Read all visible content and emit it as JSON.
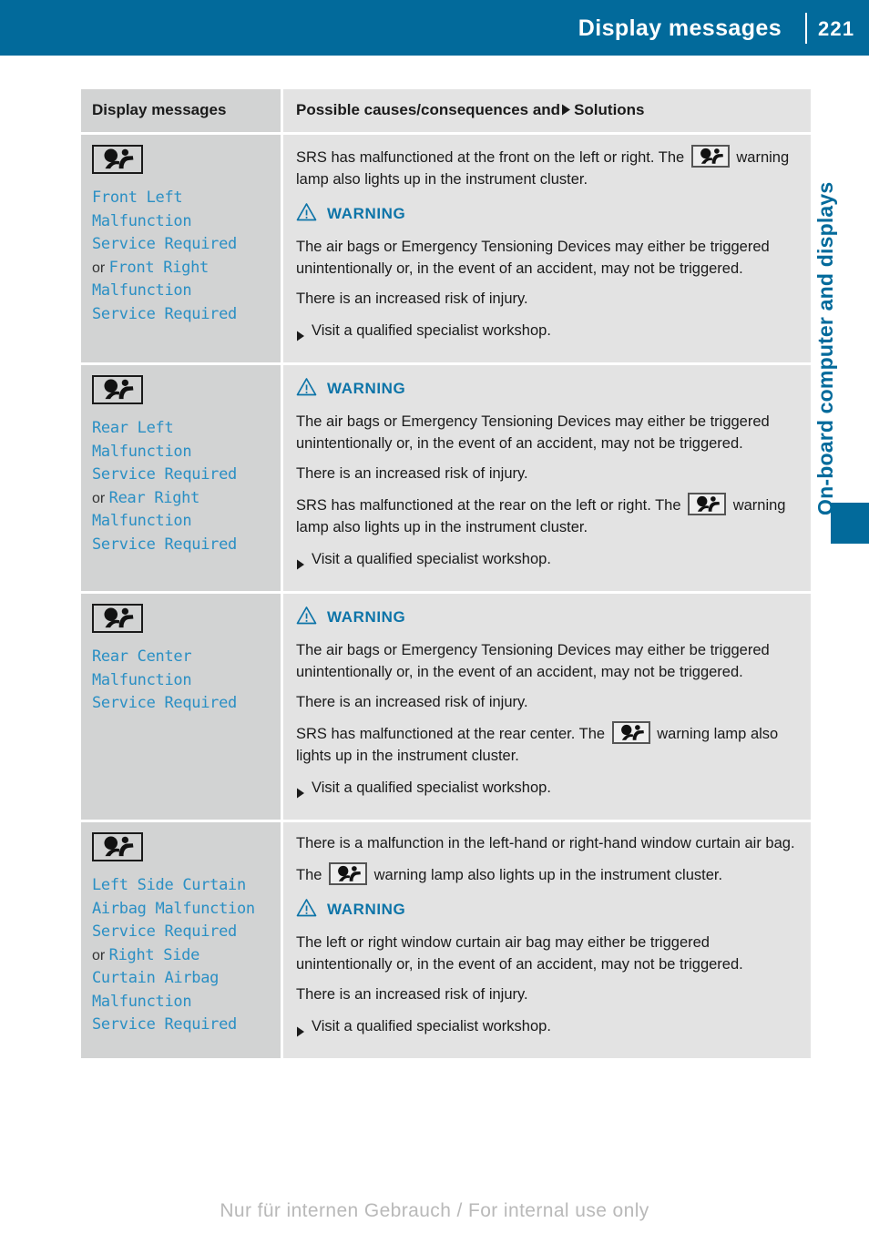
{
  "header": {
    "title": "Display messages",
    "page_number": "221"
  },
  "side": {
    "chapter_label": "On-board computer and displays"
  },
  "table": {
    "columns": {
      "left": "Display messages",
      "right_before": "Possible causes/consequences and",
      "right_after": "Solutions"
    },
    "rows": [
      {
        "icon": "srs-airbag-icon",
        "message_lines": [
          {
            "text": "Front Left",
            "style": "code"
          },
          {
            "text": "Malfunction",
            "style": "code"
          },
          {
            "text": "Service Required",
            "style": "code"
          },
          {
            "text": "or ",
            "style": "plain",
            "code_after": "Front Right"
          },
          {
            "text": "Malfunction",
            "style": "code"
          },
          {
            "text": "Service Required",
            "style": "code"
          }
        ],
        "blocks": [
          {
            "type": "text_with_icon",
            "before": "SRS has malfunctioned at the front on the left or right. The",
            "icon": "srs-airbag-icon",
            "after": "warning lamp also lights up in the instrument cluster."
          },
          {
            "type": "warning_head",
            "label": "WARNING"
          },
          {
            "type": "text",
            "text": "The air bags or Emergency Tensioning Devices may either be triggered unintentionally or, in the event of an accident, may not be triggered."
          },
          {
            "type": "text",
            "text": "There is an increased risk of injury."
          },
          {
            "type": "action",
            "text": "Visit a qualified specialist workshop."
          }
        ]
      },
      {
        "icon": "srs-airbag-icon",
        "message_lines": [
          {
            "text": "Rear Left",
            "style": "code"
          },
          {
            "text": "Malfunction",
            "style": "code"
          },
          {
            "text": "Service Required",
            "style": "code"
          },
          {
            "text": "or ",
            "style": "plain",
            "code_after": "Rear Right"
          },
          {
            "text": "Malfunction",
            "style": "code"
          },
          {
            "text": "Service Required",
            "style": "code"
          }
        ],
        "blocks": [
          {
            "type": "warning_head",
            "label": "WARNING"
          },
          {
            "type": "text",
            "text": "The air bags or Emergency Tensioning Devices may either be triggered unintentionally or, in the event of an accident, may not be triggered."
          },
          {
            "type": "text",
            "text": "There is an increased risk of injury."
          },
          {
            "type": "text_with_icon",
            "before": "SRS has malfunctioned at the rear on the left or right. The",
            "icon": "srs-airbag-icon",
            "after": "warning lamp also lights up in the instrument cluster."
          },
          {
            "type": "action",
            "text": "Visit a qualified specialist workshop."
          }
        ]
      },
      {
        "icon": "srs-airbag-icon",
        "message_lines": [
          {
            "text": "Rear Center",
            "style": "code"
          },
          {
            "text": "Malfunction",
            "style": "code"
          },
          {
            "text": "Service Required",
            "style": "code"
          }
        ],
        "blocks": [
          {
            "type": "warning_head",
            "label": "WARNING"
          },
          {
            "type": "text",
            "text": "The air bags or Emergency Tensioning Devices may either be triggered unintentionally or, in the event of an accident, may not be triggered."
          },
          {
            "type": "text",
            "text": "There is an increased risk of injury."
          },
          {
            "type": "text_with_icon",
            "before": "SRS has malfunctioned at the rear center. The",
            "icon": "srs-airbag-icon",
            "after": "warning lamp also lights up in the instrument cluster."
          },
          {
            "type": "action",
            "text": "Visit a qualified specialist workshop."
          }
        ]
      },
      {
        "icon": "srs-airbag-icon",
        "message_lines": [
          {
            "text": "Left Side Curtain",
            "style": "code"
          },
          {
            "text": "Airbag Malfunction",
            "style": "code"
          },
          {
            "text": "Service Required",
            "style": "code"
          },
          {
            "text": "or ",
            "style": "plain",
            "code_after": "Right Side"
          },
          {
            "text": "Curtain Airbag",
            "style": "code"
          },
          {
            "text": "Malfunction",
            "style": "code"
          },
          {
            "text": "Service Required",
            "style": "code"
          }
        ],
        "blocks": [
          {
            "type": "text",
            "text": "There is a malfunction in the left-hand or right-hand window curtain air bag."
          },
          {
            "type": "text_with_icon",
            "before": "The",
            "icon": "srs-airbag-icon",
            "after": "warning lamp also lights up in the instrument cluster."
          },
          {
            "type": "warning_head",
            "label": "WARNING"
          },
          {
            "type": "text",
            "text": "The left or right window curtain air bag may either be triggered unintentionally or, in the event of an accident, may not be triggered."
          },
          {
            "type": "text",
            "text": "There is an increased risk of injury."
          },
          {
            "type": "action",
            "text": "Visit a qualified specialist workshop."
          }
        ]
      }
    ]
  },
  "watermark": "Nur für internen Gebrauch / For internal use only",
  "colors": {
    "brand_blue": "#026a9b",
    "message_blue": "#2a8fc4",
    "warning_blue": "#0d74a8",
    "cell_left_bg": "#d2d3d3",
    "cell_right_bg": "#e3e3e3"
  }
}
